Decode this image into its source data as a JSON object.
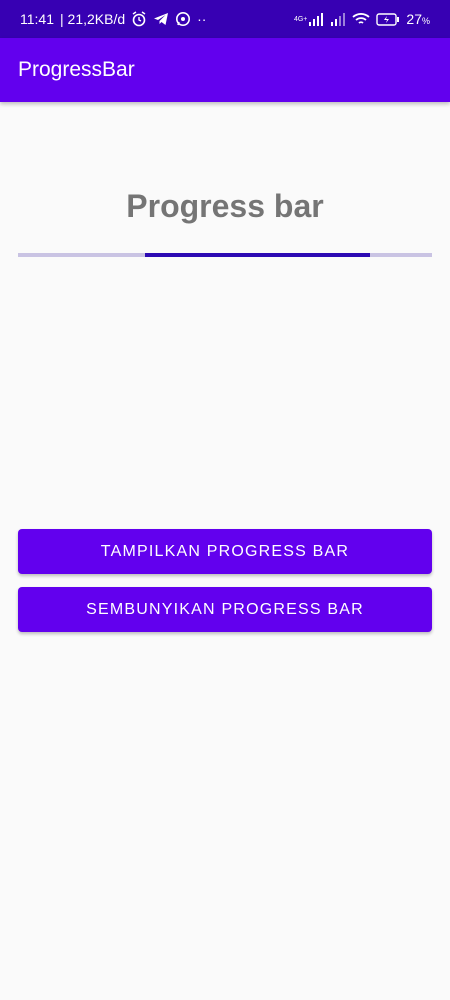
{
  "status_bar": {
    "time": "11:41",
    "speed": "| 21,2KB/d",
    "more": "··",
    "network_tag": "4G+",
    "battery": "27",
    "battery_unit": "%",
    "icons": [
      "alarm-icon",
      "telegram-icon",
      "whatsapp-icon",
      "signal-icon",
      "wifi-icon",
      "battery-icon"
    ]
  },
  "app_bar": {
    "title": "ProgressBar"
  },
  "main": {
    "heading": "Progress bar",
    "progress": {
      "start_fraction": 0.307,
      "end_fraction": 0.85,
      "indeterminate": true
    }
  },
  "buttons": {
    "show_label": "TAMPILKAN PROGRESS BAR",
    "hide_label": "SEMBUNYIKAN PROGRESS BAR"
  },
  "colors": {
    "status_bar": "#3700b3",
    "primary": "#6200ee",
    "progress_track": "#c9c3e3",
    "progress_fill": "#2c0ab3",
    "heading": "#757575"
  }
}
